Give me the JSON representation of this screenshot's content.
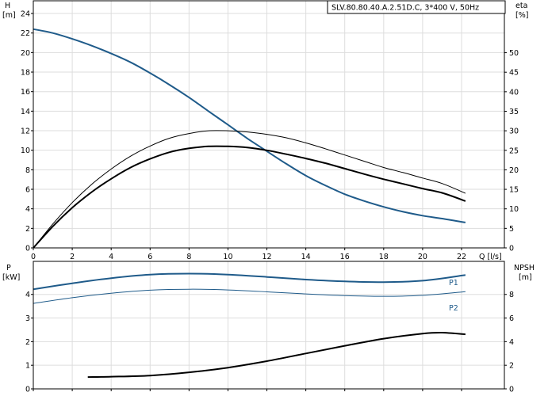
{
  "chart_data": {
    "type": "line",
    "title": "SLV.80.80.40.A.2.51D.C, 3*400 V, 50Hz",
    "panels": [
      {
        "name": "head-efficiency",
        "x_label": "Q [l/s]",
        "x_ticks": [
          0,
          2,
          4,
          6,
          8,
          10,
          12,
          14,
          16,
          18,
          20,
          22
        ],
        "xlim": [
          0,
          24.2
        ],
        "left_axis": {
          "label_top": "H",
          "label_unit": "[m]",
          "ylim": [
            0,
            25.3
          ],
          "ticks": [
            0,
            2,
            4,
            6,
            8,
            10,
            12,
            14,
            16,
            18,
            20,
            22,
            24
          ]
        },
        "right_axis": {
          "label_top": "eta",
          "label_unit": "[%]",
          "ylim": [
            0,
            63.3
          ],
          "ticks": [
            0,
            5,
            10,
            15,
            20,
            25,
            30,
            35,
            40,
            45,
            50
          ]
        },
        "series": [
          {
            "role": "head-curve",
            "axis": "left",
            "color": "#1f5b8a",
            "width": 2,
            "x": [
              0,
              1,
              2,
              3,
              4,
              5,
              6,
              7,
              8,
              9,
              10,
              11,
              12,
              13,
              14,
              15,
              16,
              17,
              18,
              19,
              20,
              21,
              22.2
            ],
            "y": [
              22.4,
              22.0,
              21.4,
              20.7,
              19.9,
              19.0,
              17.9,
              16.7,
              15.4,
              14.0,
              12.6,
              11.2,
              9.9,
              8.6,
              7.4,
              6.4,
              5.5,
              4.8,
              4.2,
              3.7,
              3.3,
              3.0,
              2.6
            ]
          },
          {
            "role": "efficiency-total",
            "axis": "right",
            "color": "#000000",
            "width": 1,
            "x": [
              0,
              1,
              2,
              3,
              4,
              5,
              6,
              7,
              8,
              9,
              10,
              11,
              12,
              13,
              14,
              15,
              16,
              17,
              18,
              19,
              20,
              21,
              22.2
            ],
            "y": [
              0,
              6.1,
              11.6,
              16.3,
              20.2,
              23.5,
              26.1,
              28.1,
              29.3,
              30.0,
              30.0,
              29.7,
              29.1,
              28.2,
              26.9,
              25.4,
              23.8,
              22.2,
              20.6,
              19.3,
              17.9,
              16.5,
              14.0
            ]
          },
          {
            "role": "efficiency-hydraulic",
            "axis": "right",
            "color": "#000000",
            "width": 2,
            "x": [
              0,
              1,
              2,
              3,
              4,
              5,
              6,
              7,
              8,
              9,
              10,
              11,
              12,
              13,
              14,
              15,
              16,
              17,
              18,
              19,
              20,
              21,
              22.2
            ],
            "y": [
              0,
              5.5,
              10.3,
              14.3,
              17.7,
              20.6,
              22.8,
              24.5,
              25.5,
              26.0,
              26.0,
              25.7,
              25.0,
              24.0,
              22.9,
              21.7,
              20.3,
              18.9,
              17.6,
              16.4,
              15.2,
              14.1,
              12.0
            ]
          }
        ]
      },
      {
        "name": "power-npsh",
        "xlim": [
          0,
          24.2
        ],
        "left_axis": {
          "label_top": "P",
          "label_unit": "[kW]",
          "ylim": [
            0,
            5.4
          ],
          "ticks": [
            0,
            1,
            2,
            3,
            4
          ]
        },
        "right_axis": {
          "label_top": "NPSH",
          "label_unit": "[m]",
          "ylim": [
            0,
            10.8
          ],
          "ticks": [
            0,
            2,
            4,
            6,
            8
          ]
        },
        "series": [
          {
            "name": "P1",
            "role": "power-p1",
            "axis": "left",
            "color": "#1f5b8a",
            "width": 2,
            "x": [
              0,
              2,
              4,
              6,
              8,
              10,
              12,
              14,
              16,
              18,
              20,
              22.2
            ],
            "y": [
              4.22,
              4.47,
              4.69,
              4.84,
              4.88,
              4.84,
              4.74,
              4.63,
              4.55,
              4.52,
              4.58,
              4.82
            ]
          },
          {
            "name": "P2",
            "role": "power-p2",
            "axis": "left",
            "color": "#1f5b8a",
            "width": 1,
            "x": [
              0,
              2,
              4,
              6,
              8,
              10,
              12,
              14,
              16,
              18,
              20,
              22.2
            ],
            "y": [
              3.62,
              3.86,
              4.05,
              4.18,
              4.22,
              4.19,
              4.11,
              4.02,
              3.95,
              3.92,
              3.96,
              4.12
            ]
          },
          {
            "role": "npsh",
            "axis": "right",
            "color": "#000000",
            "width": 2,
            "x": [
              2.8,
              4,
              6,
              8,
              10,
              12,
              14,
              16,
              18,
              20,
              21,
              22.2
            ],
            "y": [
              1.0,
              1.03,
              1.13,
              1.4,
              1.8,
              2.35,
              3.0,
              3.65,
              4.25,
              4.68,
              4.76,
              4.62
            ]
          }
        ]
      }
    ]
  }
}
